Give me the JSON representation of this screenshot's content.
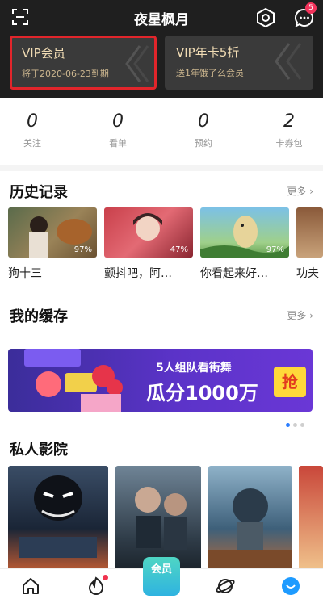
{
  "header": {
    "title": "夜星枫月",
    "notification_count": "5",
    "vip_card": {
      "title": "VIP会员",
      "subtitle": "将于2020-06-23到期"
    },
    "promo_card": {
      "title": "VIP年卡5折",
      "subtitle": "送1年饿了么会员"
    }
  },
  "stats": [
    {
      "value": "0",
      "label": "关注"
    },
    {
      "value": "0",
      "label": "看单"
    },
    {
      "value": "0",
      "label": "预约"
    },
    {
      "value": "2",
      "label": "卡券包"
    }
  ],
  "history": {
    "title": "历史记录",
    "more": "更多 ›",
    "items": [
      {
        "label": "狗十三",
        "progress": "97%"
      },
      {
        "label": "颤抖吧，阿…",
        "progress": "47%"
      },
      {
        "label": "你看起来好…",
        "progress": "97%"
      },
      {
        "label": "功夫",
        "progress": ""
      }
    ]
  },
  "cache": {
    "title": "我的缓存",
    "more": "更多 ›",
    "banner": {
      "line1": "5人组队看街舞",
      "line2": "瓜分1000万",
      "button": "抢"
    }
  },
  "cinema": {
    "title": "私人影院",
    "posters": [
      {
        "name": "poster-venom"
      },
      {
        "name": "poster-crime-film"
      },
      {
        "name": "poster-wandering-earth"
      },
      {
        "name": "poster-drama"
      }
    ]
  },
  "bottom_nav": {
    "items": [
      "home-icon",
      "discover-icon",
      "member-center",
      "planet-icon",
      "profile-icon"
    ],
    "center_label": "会员"
  },
  "colors": {
    "header_bg": "#1f1f1f",
    "vip_gold": "#f1dcb4",
    "highlight_red": "#e1252b",
    "accent_blue": "#2a7dff"
  }
}
